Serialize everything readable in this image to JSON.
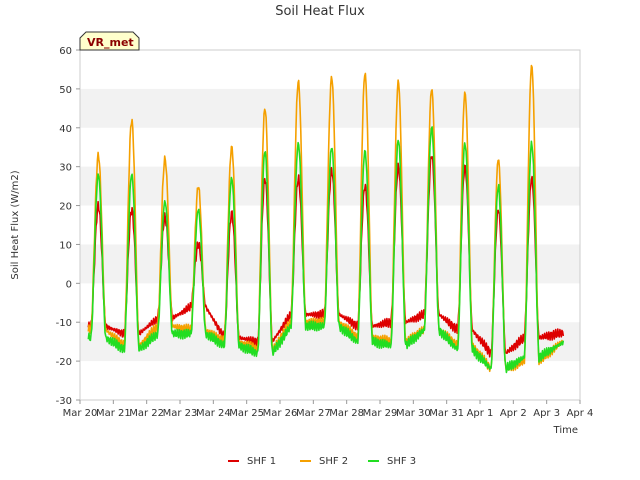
{
  "chart_data": {
    "type": "line",
    "title": "Soil Heat Flux",
    "xlabel": "Time",
    "ylabel": "Soil Heat Flux (W/m2)",
    "site_badge": "VR_met",
    "ylim": [
      -30,
      60
    ],
    "yticks": [
      -30,
      -20,
      -10,
      0,
      10,
      20,
      30,
      40,
      50,
      60
    ],
    "xlim": [
      "Mar 20",
      "Apr 4"
    ],
    "xtick_labels": [
      "Mar 20",
      "Mar 21",
      "Mar 22",
      "Mar 23",
      "Mar 24",
      "Mar 25",
      "Mar 26",
      "Mar 27",
      "Mar 28",
      "Mar 29",
      "Mar 30",
      "Mar 31",
      "Apr 1",
      "Apr 2",
      "Apr 3",
      "Apr 4"
    ],
    "data_start": "Mar 20 06:00",
    "data_end": "Apr 3 12:00",
    "grid": "horizontal bands",
    "legend_position": "bottom-center",
    "series": [
      {
        "name": "SHF 1",
        "color": "#dd0000",
        "daily": [
          {
            "date": "Mar 20",
            "min": -11,
            "max": 20
          },
          {
            "date": "Mar 21",
            "min": -13,
            "max": 19
          },
          {
            "date": "Mar 22",
            "min": -9,
            "max": 17
          },
          {
            "date": "Mar 23",
            "min": -6,
            "max": 10
          },
          {
            "date": "Mar 24",
            "min": -14,
            "max": 18
          },
          {
            "date": "Mar 25",
            "min": -15,
            "max": 27
          },
          {
            "date": "Mar 26",
            "min": -8,
            "max": 27
          },
          {
            "date": "Mar 27",
            "min": -8,
            "max": 29
          },
          {
            "date": "Mar 28",
            "min": -11,
            "max": 25
          },
          {
            "date": "Mar 29",
            "min": -10,
            "max": 30
          },
          {
            "date": "Mar 30",
            "min": -8,
            "max": 33
          },
          {
            "date": "Mar 31",
            "min": -12,
            "max": 30
          },
          {
            "date": "Apr 1",
            "min": -18,
            "max": 19
          },
          {
            "date": "Apr 2",
            "min": -14,
            "max": 27
          },
          {
            "date": "Apr 3",
            "min": -13,
            "max": null
          }
        ]
      },
      {
        "name": "SHF 2",
        "color": "#f5a000",
        "daily": [
          {
            "date": "Mar 20",
            "min": -12,
            "max": 33
          },
          {
            "date": "Mar 21",
            "min": -16,
            "max": 42
          },
          {
            "date": "Mar 22",
            "min": -11,
            "max": 32
          },
          {
            "date": "Mar 23",
            "min": -12,
            "max": 25
          },
          {
            "date": "Mar 24",
            "min": -15,
            "max": 35
          },
          {
            "date": "Mar 25",
            "min": -17,
            "max": 45
          },
          {
            "date": "Mar 26",
            "min": -10,
            "max": 52
          },
          {
            "date": "Mar 27",
            "min": -10,
            "max": 53
          },
          {
            "date": "Mar 28",
            "min": -14,
            "max": 54
          },
          {
            "date": "Mar 29",
            "min": -15,
            "max": 52
          },
          {
            "date": "Mar 30",
            "min": -12,
            "max": 50
          },
          {
            "date": "Mar 31",
            "min": -16,
            "max": 49
          },
          {
            "date": "Apr 1",
            "min": -22,
            "max": 32
          },
          {
            "date": "Apr 2",
            "min": -20,
            "max": 56
          },
          {
            "date": "Apr 3",
            "min": -16,
            "max": null
          }
        ]
      },
      {
        "name": "SHF 3",
        "color": "#22dd22",
        "daily": [
          {
            "date": "Mar 20",
            "min": -14,
            "max": 28
          },
          {
            "date": "Mar 21",
            "min": -17,
            "max": 28
          },
          {
            "date": "Mar 22",
            "min": -13,
            "max": 21
          },
          {
            "date": "Mar 23",
            "min": -13,
            "max": 19
          },
          {
            "date": "Mar 24",
            "min": -16,
            "max": 27
          },
          {
            "date": "Mar 25",
            "min": -18,
            "max": 34
          },
          {
            "date": "Mar 26",
            "min": -11,
            "max": 36
          },
          {
            "date": "Mar 27",
            "min": -11,
            "max": 35
          },
          {
            "date": "Mar 28",
            "min": -15,
            "max": 34
          },
          {
            "date": "Mar 29",
            "min": -16,
            "max": 37
          },
          {
            "date": "Mar 30",
            "min": -12,
            "max": 40
          },
          {
            "date": "Mar 31",
            "min": -17,
            "max": 36
          },
          {
            "date": "Apr 1",
            "min": -22,
            "max": 25
          },
          {
            "date": "Apr 2",
            "min": -19,
            "max": 36
          },
          {
            "date": "Apr 3",
            "min": -16,
            "max": null
          }
        ]
      }
    ]
  }
}
